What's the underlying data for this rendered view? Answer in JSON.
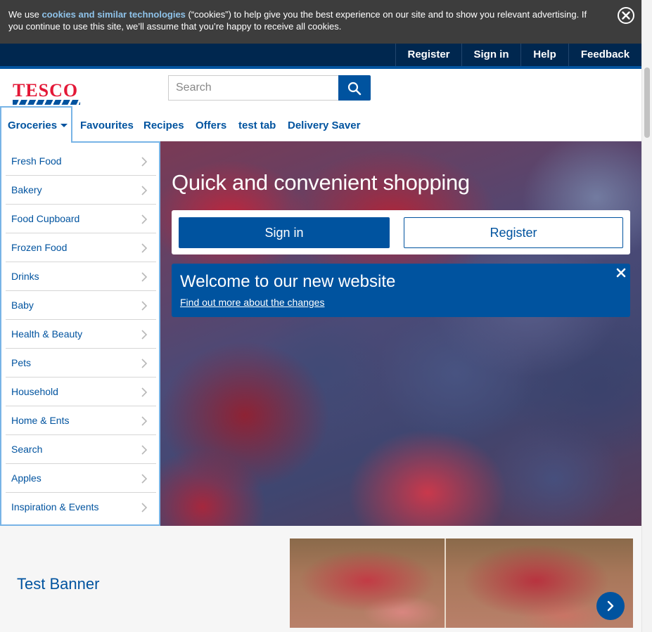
{
  "cookie_banner": {
    "text_before": "We use ",
    "link": "cookies and similar technologies",
    "text_after": " (“cookies”) to help give you the best experience on our site and to show you relevant advertising. If you continue to use this site, we’ll assume that you’re happy to receive all cookies.",
    "close_icon": "close-circle-icon"
  },
  "utility_nav": {
    "items": [
      "Register",
      "Sign in",
      "Help",
      "Feedback"
    ]
  },
  "header": {
    "logo": "TESCO",
    "search": {
      "placeholder": "Search",
      "value": "",
      "icon": "search-icon"
    }
  },
  "main_nav": {
    "items": [
      "Groceries",
      "Favourites",
      "Recipes",
      "Offers",
      "test tab",
      "Delivery Saver"
    ]
  },
  "groceries_menu": {
    "items": [
      "Fresh Food",
      "Bakery",
      "Food Cupboard",
      "Frozen Food",
      "Drinks",
      "Baby",
      "Health & Beauty",
      "Pets",
      "Household",
      "Home & Ents",
      "Search",
      "Apples",
      "Inspiration & Events"
    ]
  },
  "hero": {
    "title": "Quick and convenient shopping",
    "sign_in": "Sign in",
    "register": "Register"
  },
  "welcome": {
    "title": "Welcome to our new website",
    "link": "Find out more about the changes"
  },
  "banner": {
    "title": "Test Banner",
    "next_icon": "chevron-right-icon"
  },
  "colors": {
    "brand_blue": "#00539f",
    "dark_navy": "#00274f",
    "tesco_red": "#e31837",
    "cookie_bg": "#3d3d3d"
  }
}
